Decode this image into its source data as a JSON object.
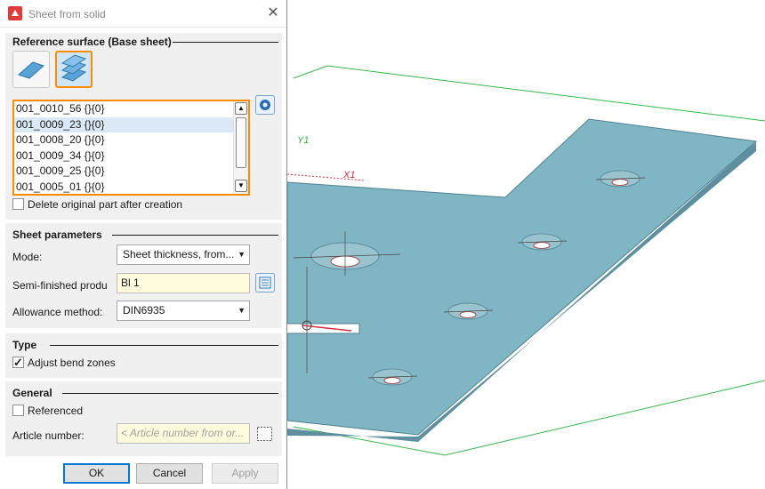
{
  "dialog": {
    "title": "Sheet from solid",
    "close_glyph": "✕"
  },
  "reference_surface": {
    "header": "Reference surface (Base sheet)",
    "items": [
      "001_0010_56 {}{0}",
      "001_0009_23 {}{0}",
      "001_0008_20 {}{0}",
      "001_0009_34 {}{0}",
      "001_0009_25 {}{0}",
      "001_0005_01 {}{0}"
    ],
    "selected_index": 1,
    "delete_original_label": "Delete original part after creation",
    "delete_original_checked": false
  },
  "sheet_parameters": {
    "header": "Sheet parameters",
    "mode_label": "Mode:",
    "mode_value": "Sheet thickness, from...",
    "semi_label": "Semi-finished produ",
    "semi_value": "Bl 1",
    "allowance_label": "Allowance method:",
    "allowance_value": "DIN6935"
  },
  "type": {
    "header": "Type",
    "adjust_label": "Adjust bend zones",
    "adjust_checked": true
  },
  "general": {
    "header": "General",
    "referenced_label": "Referenced",
    "referenced_checked": false,
    "article_label": "Article number:",
    "article_placeholder": "< Article number from or..."
  },
  "buttons": {
    "ok": "OK",
    "cancel": "Cancel",
    "apply": "Apply"
  },
  "viewport": {
    "axis_y": "Y1",
    "axis_x": "X1"
  },
  "icons": {
    "app": "app-logo-icon",
    "close": "close-icon",
    "single_sheet": "single-sheet-icon",
    "stacked_sheets": "stacked-sheets-icon",
    "settings": "settings-gear-icon",
    "catalog": "catalog-icon",
    "article_browse": "article-browse-icon"
  },
  "colors": {
    "accent_orange": "#ff8c00",
    "sheet_face": "#7fb3c3",
    "sheet_edge": "#5d8f9f",
    "boundary_green": "#39b54a",
    "axis_red": "#cc3344"
  }
}
